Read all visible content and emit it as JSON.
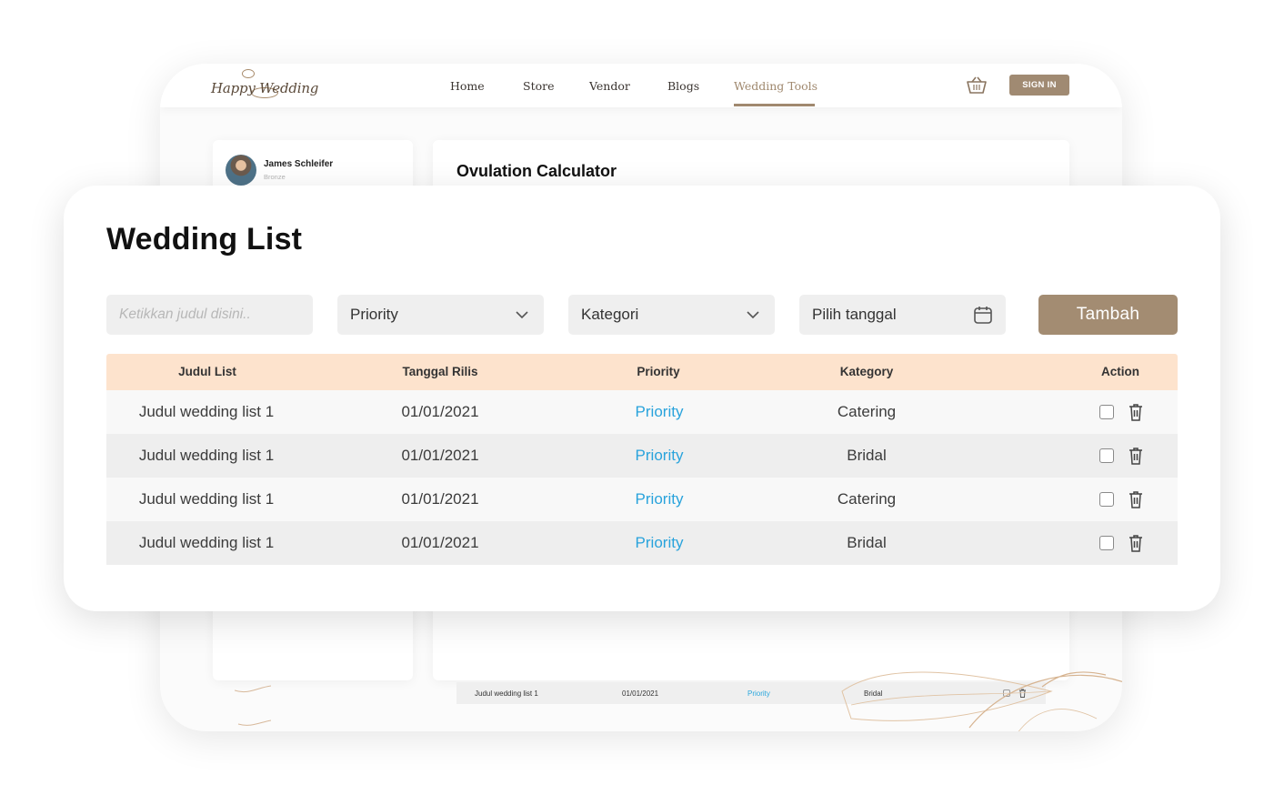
{
  "nav": {
    "logo": "Happy Wedding",
    "links": [
      "Home",
      "Store",
      "Vendor",
      "Blogs",
      "Wedding Tools"
    ],
    "active_link": "Wedding Tools",
    "sign_in": "SIGN IN"
  },
  "profile": {
    "name": "James Schleifer",
    "tier": "Bronze"
  },
  "background_page": {
    "title": "Ovulation Calculator",
    "partial_row": {
      "title": "Judul wedding list 1",
      "date": "01/01/2021",
      "priority": "Priority",
      "category": "Bridal"
    }
  },
  "wedding_list": {
    "title": "Wedding List",
    "search_placeholder": "Ketikkan judul disini..",
    "priority_select": "Priority",
    "category_select": "Kategori",
    "date_picker": "Pilih tanggal",
    "add_button": "Tambah",
    "columns": [
      "Judul List",
      "Tanggal Rilis",
      "Priority",
      "Kategory",
      "Action"
    ],
    "rows": [
      {
        "title": "Judul wedding list 1",
        "date": "01/01/2021",
        "priority": "Priority",
        "category": "Catering"
      },
      {
        "title": "Judul wedding list 1",
        "date": "01/01/2021",
        "priority": "Priority",
        "category": "Bridal"
      },
      {
        "title": "Judul wedding list 1",
        "date": "01/01/2021",
        "priority": "Priority",
        "category": "Catering"
      },
      {
        "title": "Judul wedding list 1",
        "date": "01/01/2021",
        "priority": "Priority",
        "category": "Bridal"
      }
    ]
  },
  "colors": {
    "brand": "#a38c72",
    "table_header": "#fde3cd",
    "priority_link": "#29a3dc"
  }
}
